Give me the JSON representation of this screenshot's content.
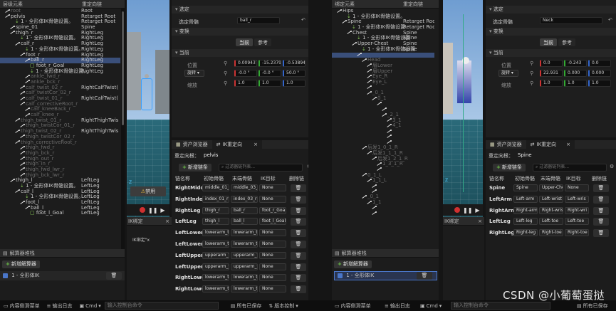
{
  "left": {
    "hierarchy": {
      "col_element": "层级元素",
      "col_chain": "重定向链",
      "rows": [
        {
          "name": "root",
          "chain": "Root",
          "indent": 1,
          "kind": "bone",
          "dim": true
        },
        {
          "name": "pelvis",
          "chain": "Retarget Root",
          "indent": 1,
          "kind": "bone"
        },
        {
          "name": "1 - 全形体IK骨骼设置。",
          "chain": "Retarget Root",
          "indent": 3,
          "kind": "goal"
        },
        {
          "name": "spine_01",
          "chain": "Spine",
          "indent": 2,
          "kind": "bone"
        },
        {
          "name": "thigh_r",
          "chain": "RightLeg",
          "indent": 2,
          "kind": "bone"
        },
        {
          "name": "1 - 全形体IK骨骼设置。",
          "chain": "RightLeg",
          "indent": 4,
          "kind": "goal"
        },
        {
          "name": "calf_r",
          "chain": "RightLeg",
          "indent": 3,
          "kind": "bone"
        },
        {
          "name": "1 - 全形体IK骨骼设置。",
          "chain": "RightLeg",
          "indent": 5,
          "kind": "goal"
        },
        {
          "name": "foot_r",
          "chain": "RightLeg",
          "indent": 4,
          "kind": "bone"
        },
        {
          "name": "ball_r",
          "chain": "RightLeg",
          "indent": 5,
          "kind": "bone",
          "sel": true
        },
        {
          "name": "foot_r_Goal",
          "chain": "RightLeg",
          "indent": 6,
          "kind": "goalbox"
        },
        {
          "name": "1 - 全形体IK骨骼设置。",
          "chain": "RightLeg",
          "indent": 6,
          "kind": "goal"
        },
        {
          "name": "ankle_fwd_r",
          "chain": "",
          "indent": 5,
          "kind": "bone",
          "dim": true
        },
        {
          "name": "ankle_bck_r",
          "chain": "",
          "indent": 5,
          "kind": "bone",
          "dim": true
        },
        {
          "name": "calf_twist_02_r",
          "chain": "RightCalfTwist(",
          "indent": 4,
          "kind": "bone",
          "dim": true
        },
        {
          "name": "calf_twistCor_02_r",
          "chain": "",
          "indent": 4,
          "kind": "bone",
          "dim": true
        },
        {
          "name": "calf_twist_01_r",
          "chain": "RightCalfTwist(",
          "indent": 4,
          "kind": "bone",
          "dim": true
        },
        {
          "name": "calf_correctiveRoot_r",
          "chain": "",
          "indent": 4,
          "kind": "bone",
          "dim": true
        },
        {
          "name": "calf_kneeBack_r",
          "chain": "",
          "indent": 5,
          "kind": "bone",
          "dim": true
        },
        {
          "name": "calf_knee_r",
          "chain": "",
          "indent": 5,
          "kind": "bone",
          "dim": true
        },
        {
          "name": "thigh_twist_01_r",
          "chain": "RightThighTwis",
          "indent": 3,
          "kind": "bone",
          "dim": true
        },
        {
          "name": "thigh_twistCor_01_r",
          "chain": "",
          "indent": 4,
          "kind": "bone",
          "dim": true
        },
        {
          "name": "thigh_twist_02_r",
          "chain": "RightThighTwis",
          "indent": 3,
          "kind": "bone",
          "dim": true
        },
        {
          "name": "thigh_twistCor_02_r",
          "chain": "",
          "indent": 4,
          "kind": "bone",
          "dim": true
        },
        {
          "name": "thigh_correctiveRoot_r",
          "chain": "",
          "indent": 3,
          "kind": "bone",
          "dim": true
        },
        {
          "name": "thigh_fwd_r",
          "chain": "",
          "indent": 4,
          "kind": "bone",
          "dim": true
        },
        {
          "name": "thigh_bck_r",
          "chain": "",
          "indent": 4,
          "kind": "bone",
          "dim": true
        },
        {
          "name": "thigh_out_r",
          "chain": "",
          "indent": 4,
          "kind": "bone",
          "dim": true
        },
        {
          "name": "thigh_in_r",
          "chain": "",
          "indent": 4,
          "kind": "bone",
          "dim": true
        },
        {
          "name": "thigh_fwd_lwr_r",
          "chain": "",
          "indent": 4,
          "kind": "bone",
          "dim": true
        },
        {
          "name": "thigh_bck_lwr_r",
          "chain": "",
          "indent": 4,
          "kind": "bone",
          "dim": true
        },
        {
          "name": "thigh_l",
          "chain": "LeftLeg",
          "indent": 2,
          "kind": "bone"
        },
        {
          "name": "1 - 全形体IK骨骼设置。",
          "chain": "LeftLeg",
          "indent": 4,
          "kind": "goal"
        },
        {
          "name": "calf_l",
          "chain": "LeftLeg",
          "indent": 3,
          "kind": "bone"
        },
        {
          "name": "1 - 全形体IK骨骼设置。",
          "chain": "LeftLeg",
          "indent": 5,
          "kind": "goal"
        },
        {
          "name": "foot_l",
          "chain": "LeftLeg",
          "indent": 4,
          "kind": "bone"
        },
        {
          "name": "ball_l",
          "chain": "LeftLeg",
          "indent": 5,
          "kind": "bone"
        },
        {
          "name": "foot_l_Goal",
          "chain": "LeftLeg",
          "indent": 6,
          "kind": "goalbox"
        }
      ]
    },
    "solver_stack": {
      "title": "解算器堆栈",
      "add": "新增解算器",
      "item": "1 - 全形体IK"
    },
    "viewport": {
      "overlay_btn": "禁用"
    },
    "details": {
      "sec_selection": "选定",
      "sel_label": "选定骨骼",
      "sel_value": "ball_r",
      "sec_transform": "变换",
      "tab_current": "当前",
      "tab_ref": "参考",
      "sec_current": "当前",
      "pos_label": "位置",
      "pos": [
        "0.009437",
        "-15.2379",
        "-0.53894"
      ],
      "rot_label": "旋转",
      "rot": [
        "-0.0 °",
        "-0.0 °",
        "50.0 °"
      ],
      "scale_label": "缩放",
      "scale": [
        "1.0",
        "1.0",
        "1.0"
      ]
    },
    "tabs": {
      "assets": "资产浏览器",
      "ik": "IK重定向"
    },
    "retarget": {
      "root_label": "重定向根：",
      "root_value": "pelvis",
      "add_chain": "新增链条",
      "search_ph": "过滤器链列表...",
      "cols": [
        "链名称",
        "初始骨骼",
        "末端骨骼",
        "IK目标",
        "删除链"
      ],
      "chains": [
        {
          "name": "RightMiddl",
          "start": "middle_01_r",
          "end": "middle_03_r",
          "goal": "None"
        },
        {
          "name": "RightIndex",
          "start": "index_01_r",
          "end": "index_03_r",
          "goal": "None"
        },
        {
          "name": "RightLeg",
          "start": "thigh_r",
          "end": "ball_r",
          "goal": "foot_r_Goa"
        },
        {
          "name": "LeftLeg",
          "start": "thigh_l",
          "end": "ball_l",
          "goal": "foot_l_Goal"
        },
        {
          "name": "LeftLowerA",
          "start": "lowerarm_tw",
          "end": "lowerarm_tw",
          "goal": "None"
        },
        {
          "name": "LeftLowerA",
          "start": "lowerarm_tw",
          "end": "lowerarm_tw",
          "goal": "None"
        },
        {
          "name": "LeftUpperA",
          "start": "upperarm_tw",
          "end": "upperarm_tw",
          "goal": "None"
        },
        {
          "name": "LeftUpperA",
          "start": "upperarm_tw",
          "end": "upperarm_tw",
          "goal": "None"
        },
        {
          "name": "RightLowe",
          "start": "lowerarm_tw",
          "end": "lowerarm_tw",
          "goal": "None"
        },
        {
          "name": "RightLowe",
          "start": "lowerarm_tw",
          "end": "lowerarm_tw",
          "goal": "None"
        }
      ]
    },
    "ikbind": {
      "title": "IK绑定",
      "line": "IK绑定\"x"
    }
  },
  "right": {
    "hierarchy": {
      "col_element": "绑定元素",
      "col_chain": "重定向链",
      "rows": [
        {
          "name": "Hips",
          "chain": "",
          "indent": 1,
          "kind": "bone"
        },
        {
          "name": "1 - 全形体IK骨骼设置。",
          "chain": "",
          "indent": 3,
          "kind": "goal"
        },
        {
          "name": "Spine",
          "chain": "Retarget Roo",
          "indent": 2,
          "kind": "bone"
        },
        {
          "name": "1 - 全形体IK骨骼设置",
          "chain": "Retarget Roo",
          "indent": 4,
          "kind": "goal"
        },
        {
          "name": "Chest",
          "chain": "Spine",
          "indent": 3,
          "kind": "bone"
        },
        {
          "name": "1 - 全形体IK骨骼设置",
          "chain": "Spine",
          "indent": 5,
          "kind": "goal"
        },
        {
          "name": "Upper-Chest",
          "chain": "Spine",
          "indent": 4,
          "kind": "bone"
        },
        {
          "name": "1 - 全形体IK骨骼设置",
          "chain": "Spine",
          "indent": 6,
          "kind": "goal"
        },
        {
          "name": "",
          "chain": "",
          "indent": 5,
          "kind": "bone",
          "sel": true
        },
        {
          "name": "Head",
          "chain": "",
          "indent": 6,
          "kind": "bone",
          "dim": true
        },
        {
          "name": "眉Lower",
          "chain": "",
          "indent": 7,
          "kind": "bone",
          "dim": true
        },
        {
          "name": "眉Upper",
          "chain": "",
          "indent": 7,
          "kind": "bone",
          "dim": true
        },
        {
          "name": "Eye_R",
          "chain": "",
          "indent": 7,
          "kind": "bone",
          "dim": true
        },
        {
          "name": "Eye_L",
          "chain": "",
          "indent": 7,
          "kind": "bone",
          "dim": true
        },
        {
          "name": "",
          "chain": "",
          "indent": 7,
          "kind": "bone",
          "dim": true
        },
        {
          "name": "_0_1",
          "chain": "",
          "indent": 7,
          "kind": "bone",
          "dim": true
        },
        {
          "name": "0_1",
          "chain": "",
          "indent": 8,
          "kind": "bone",
          "dim": true
        },
        {
          "name": "",
          "chain": "",
          "indent": 9,
          "kind": "bone",
          "dim": true
        },
        {
          "name": "",
          "chain": "",
          "indent": 10,
          "kind": "bone",
          "dim": true
        },
        {
          "name": "_2_1",
          "chain": "",
          "indent": 10,
          "kind": "bone",
          "dim": true
        },
        {
          "name": "3_1",
          "chain": "",
          "indent": 11,
          "kind": "bone",
          "dim": true
        },
        {
          "name": "4_1",
          "chain": "",
          "indent": 11,
          "kind": "bone",
          "dim": true
        },
        {
          "name": "",
          "chain": "",
          "indent": 11,
          "kind": "bone",
          "dim": true
        },
        {
          "name": "",
          "chain": "",
          "indent": 11,
          "kind": "bone",
          "dim": true
        },
        {
          "name": "",
          "chain": "",
          "indent": 11,
          "kind": "bone",
          "dim": true
        },
        {
          "name": "后发1_0_1_R",
          "chain": "",
          "indent": 6,
          "kind": "bone",
          "dim": true
        },
        {
          "name": "后发1_1_1_R",
          "chain": "",
          "indent": 7,
          "kind": "bone",
          "dim": true
        },
        {
          "name": "后发1_2_1_R",
          "chain": "",
          "indent": 8,
          "kind": "bone",
          "dim": true
        },
        {
          "name": "1_3_1_R",
          "chain": "",
          "indent": 9,
          "kind": "bone",
          "dim": true
        },
        {
          "name": "",
          "chain": "",
          "indent": 9,
          "kind": "bone",
          "dim": true
        },
        {
          "name": "0_1_L",
          "chain": "",
          "indent": 6,
          "kind": "bone",
          "dim": true
        },
        {
          "name": "1_1_L",
          "chain": "",
          "indent": 7,
          "kind": "bone",
          "dim": true
        },
        {
          "name": "",
          "chain": "",
          "indent": 8,
          "kind": "bone",
          "dim": true
        },
        {
          "name": "",
          "chain": "",
          "indent": 8,
          "kind": "bone",
          "dim": true
        },
        {
          "name": "_0_1",
          "chain": "",
          "indent": 6,
          "kind": "bone",
          "dim": true
        },
        {
          "name": "1_1",
          "chain": "",
          "indent": 7,
          "kind": "bone",
          "dim": true
        },
        {
          "name": "",
          "chain": "",
          "indent": 8,
          "kind": "bone",
          "dim": true
        },
        {
          "name": "",
          "chain": "",
          "indent": 8,
          "kind": "bone",
          "dim": true
        }
      ]
    },
    "solver_stack": {
      "title": "解算器堆栈",
      "add": "新增解算器",
      "item": "1 - 全形体IK"
    },
    "details": {
      "sec_selection": "选定",
      "sel_label": "选定骨骼",
      "sel_value": "Neck",
      "sec_transform": "变换",
      "tab_current": "当前",
      "tab_ref": "参考",
      "sec_current": "当前",
      "pos_label": "位置",
      "pos": [
        "0.0",
        "-0.243",
        "0.0"
      ],
      "rot_label": "旋转",
      "rot": [
        "22.931",
        "0.000",
        "0.000"
      ],
      "scale_label": "缩放",
      "scale": [
        "1.0",
        "1.0",
        "1.0"
      ]
    },
    "tabs": {
      "assets": "资产浏览器",
      "ik": "IK重定向"
    },
    "retarget": {
      "root_label": "重定向根：",
      "root_value": "Spine",
      "add_chain": "新增链条",
      "search_ph": "过滤器链列表...",
      "cols": [
        "链名称",
        "初始骨骼",
        "末端骨骼",
        "IK目标",
        "删除链"
      ],
      "chains": [
        {
          "name": "Spine",
          "start": "Spine",
          "end": "Upper-Che",
          "goal": "None"
        },
        {
          "name": "LeftArm",
          "start": "Left-arm",
          "end": "Left-wrist",
          "goal": "Left-wris"
        },
        {
          "name": "RightArm",
          "start": "Right-arm",
          "end": "Right-wrist",
          "goal": "Right-wri"
        },
        {
          "name": "LeftLeg",
          "start": "Left-leg",
          "end": "Left-toe",
          "goal": "Left-toe"
        },
        {
          "name": "RightLeg",
          "start": "Right-leg",
          "end": "Right-toe",
          "goal": "Right-toe"
        }
      ]
    },
    "ikbind": {
      "title": "IK绑定"
    }
  },
  "status": {
    "content_drawer": "内容侧滑菜单",
    "output_log": "输出日志",
    "cmd": "Cmd",
    "cmd_ph": "输入控制台命令",
    "all_saved": "所有已保存",
    "version_control": "版本控制"
  },
  "watermark": "CSDN @小葡萄蛋挞",
  "colors": {
    "accent_green": "#6fc94a",
    "selection": "#3a4f7a",
    "record": "#d03030"
  }
}
